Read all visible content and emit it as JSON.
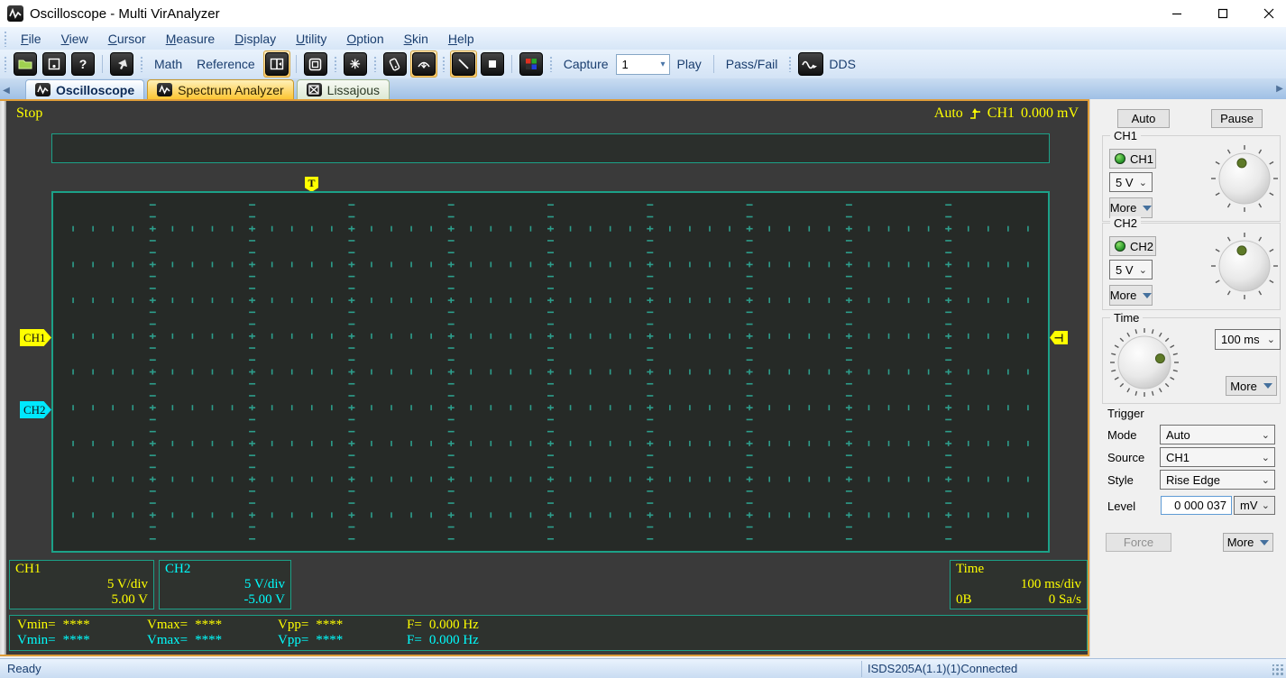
{
  "window": {
    "title": "Oscilloscope - Multi VirAnalyzer"
  },
  "menu": {
    "items": [
      {
        "label": "File"
      },
      {
        "label": "View"
      },
      {
        "label": "Cursor"
      },
      {
        "label": "Measure"
      },
      {
        "label": "Display"
      },
      {
        "label": "Utility"
      },
      {
        "label": "Option"
      },
      {
        "label": "Skin"
      },
      {
        "label": "Help"
      }
    ]
  },
  "toolbar": {
    "math_label": "Math",
    "reference_label": "Reference",
    "capture_label": "Capture",
    "capture_value": "1",
    "play_label": "Play",
    "passfail_label": "Pass/Fail",
    "dds_label": "DDS"
  },
  "tabs": {
    "items": [
      {
        "label": "Oscilloscope"
      },
      {
        "label": "Spectrum Analyzer"
      },
      {
        "label": "Lissajous"
      }
    ]
  },
  "scope": {
    "run_status": "Stop",
    "trigger_readout": {
      "mode": "Auto",
      "source": "CH1",
      "level": "0.000 mV"
    },
    "t_marker": "T",
    "ch1_marker": "CH1",
    "ch2_marker": "CH2",
    "ch1_info": {
      "title": "CH1",
      "scale": "5 V/div",
      "offset": "5.00 V"
    },
    "ch2_info": {
      "title": "CH2",
      "scale": "5 V/div",
      "offset": "-5.00 V"
    },
    "time_info": {
      "title": "Time",
      "scale": "100 ms/div",
      "buffer": "0B",
      "rate": "0 Sa/s"
    },
    "measurements": {
      "rows": [
        {
          "vmin_label": "Vmin=",
          "vmin_value": "****",
          "vmax_label": "Vmax=",
          "vmax_value": "****",
          "vpp_label": "Vpp=",
          "vpp_value": "****",
          "f_label": "F=",
          "f_value": "0.000 Hz"
        },
        {
          "vmin_label": "Vmin=",
          "vmin_value": "****",
          "vmax_label": "Vmax=",
          "vmax_value": "****",
          "vpp_label": "Vpp=",
          "vpp_value": "****",
          "f_label": "F=",
          "f_value": "0.000 Hz"
        }
      ]
    }
  },
  "panel": {
    "auto_button": "Auto",
    "pause_button": "Pause",
    "ch1": {
      "group": "CH1",
      "toggle": "CH1",
      "scale": "5 V",
      "more": "More"
    },
    "ch2": {
      "group": "CH2",
      "toggle": "CH2",
      "scale": "5 V",
      "more": "More"
    },
    "time": {
      "group": "Time",
      "base": "100 ms",
      "more": "More"
    },
    "trigger": {
      "group": "Trigger",
      "mode_label": "Mode",
      "mode": "Auto",
      "source_label": "Source",
      "source": "CH1",
      "style_label": "Style",
      "style": "Rise Edge",
      "level_label": "Level",
      "level": "0 000 037",
      "unit": "mV",
      "force": "Force",
      "more": "More"
    }
  },
  "status": {
    "ready": "Ready",
    "device": "ISDS205A(1.1)(1)Connected"
  },
  "icons": {
    "app-icon": "waveform badge",
    "open-icon": "green folder",
    "save-icon": "floppy",
    "help-icon": "?",
    "pointer-icon": "cursor arrow",
    "split-panel-icon": "split window",
    "fullscreen-icon": "square outline",
    "autoset-icon": "converge star",
    "device-icon": "handheld device",
    "sweep-icon": "sweep arc",
    "line-icon": "diagonal line",
    "stop-icon": "filled square",
    "color-grid-icon": "rgb squares",
    "dds-icon": "wave badge",
    "rise-edge-icon": "rising step arrow",
    "trigger-level-icon": "left tab marker",
    "knob-icon": "rotary dial",
    "chevron-down-icon": "v",
    "more-arrow-icon": "blue triangle"
  },
  "colors": {
    "accent_yellow": "#ffff00",
    "accent_cyan": "#00ffff",
    "graticule": "#2d9e8c",
    "scope_border": "#1ca188",
    "pane_border": "#df9d39",
    "grid_bg": "#262a27",
    "scope_bg": "#3a3a3a"
  }
}
